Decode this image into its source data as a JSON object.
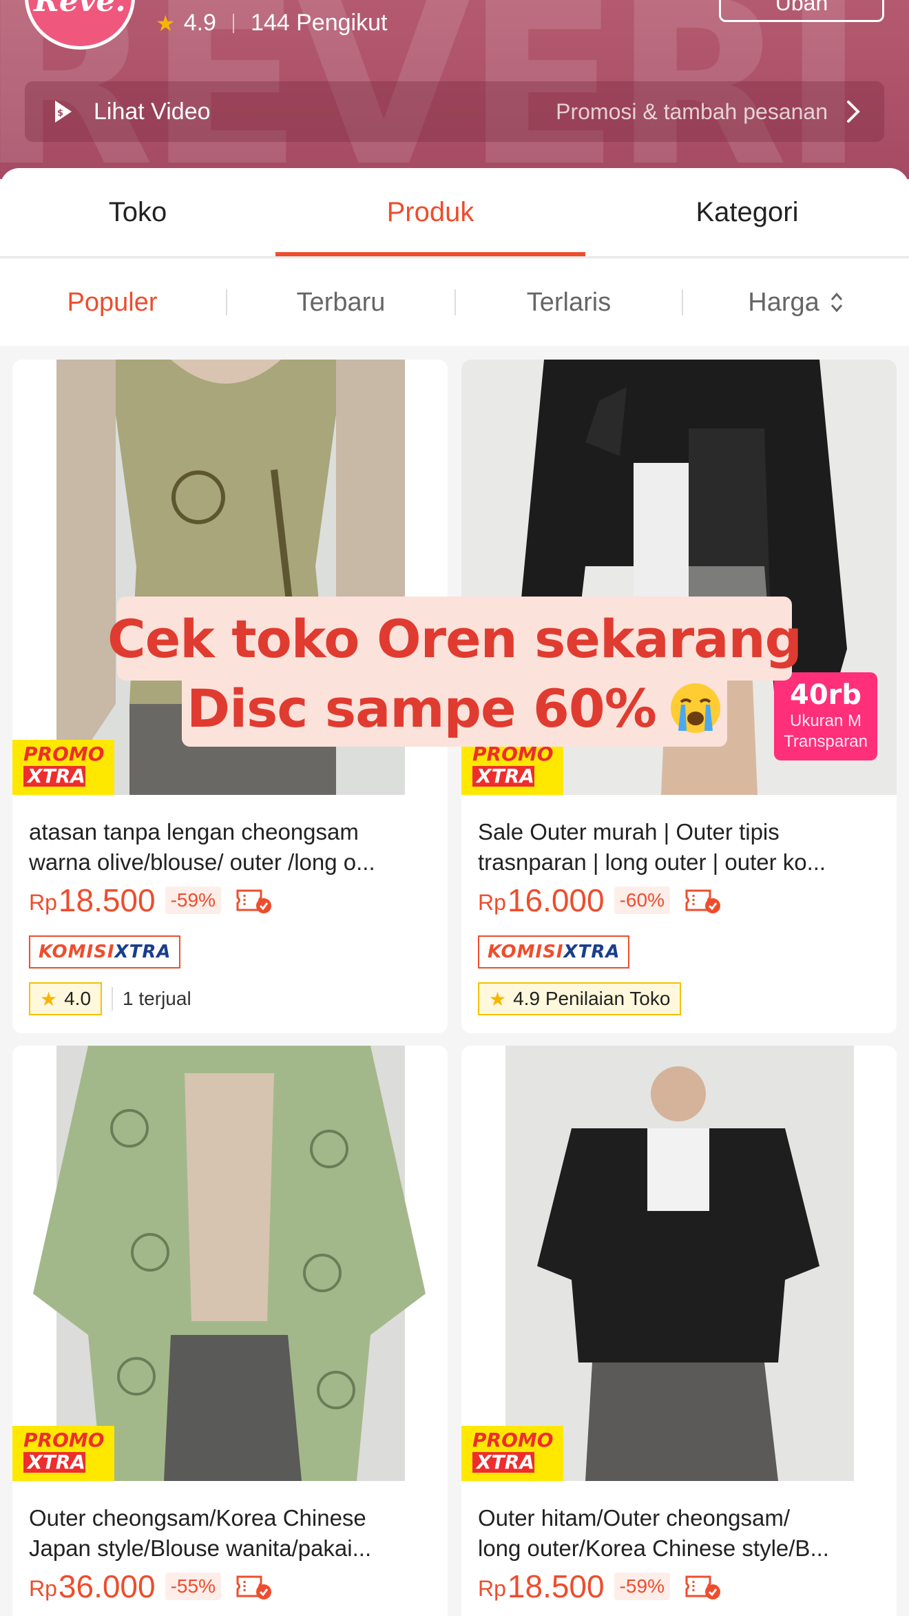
{
  "header": {
    "logo_text": "Reve.",
    "bg_text": "REVERI",
    "rating": "4.9",
    "followers": "144 Pengikut",
    "edit_button": "Ubah",
    "video_label": "Lihat Video",
    "video_promo": "Promosi & tambah pesanan"
  },
  "tabs": [
    {
      "label": "Toko",
      "active": false
    },
    {
      "label": "Produk",
      "active": true
    },
    {
      "label": "Kategori",
      "active": false
    }
  ],
  "sort": [
    {
      "label": "Populer",
      "active": true
    },
    {
      "label": "Terbaru",
      "active": false
    },
    {
      "label": "Terlaris",
      "active": false
    },
    {
      "label": "Harga",
      "active": false
    }
  ],
  "badges": {
    "promo_line1": "PROMO",
    "promo_line2": "XTRA",
    "komisi_part1": "KOMISI",
    "komisi_part2": "XTRA",
    "currency": "Rp"
  },
  "products": [
    {
      "title_line1": "atasan tanpa lengan cheongsam",
      "title_line2": "warna olive/blouse/ outer /long o...",
      "price": "18.500",
      "discount": "-59%",
      "rating": "4.0",
      "sold": "1 terjual"
    },
    {
      "title_line1": "Sale Outer murah | Outer tipis",
      "title_line2": "trasnparan | long outer | outer ko...",
      "price": "16.000",
      "discount": "-60%",
      "shop_rating": "4.9 Penilaian Toko"
    },
    {
      "title_line1": "Outer cheongsam/Korea Chinese",
      "title_line2": "Japan style/Blouse wanita/pakai...",
      "price": "36.000",
      "discount": "-55%"
    },
    {
      "title_line1": "Outer hitam/Outer cheongsam/",
      "title_line2": "long outer/Korea Chinese style/B...",
      "price": "18.500",
      "discount": "-59%"
    }
  ],
  "side_tag": {
    "big": "40rb",
    "line1": "Ukuran M",
    "line2": "Transparan"
  },
  "overlay": {
    "line1": "Cek toko Oren sekarang",
    "line2": "Disc sampe 60%",
    "emoji": "crying-face-icon"
  },
  "colors": {
    "accent": "#ee4d2d",
    "header": "#a54a63",
    "promo_yellow": "#ffe800",
    "komisi_blue": "#1a3e8c",
    "side_tag_pink": "#ff2f7a"
  }
}
